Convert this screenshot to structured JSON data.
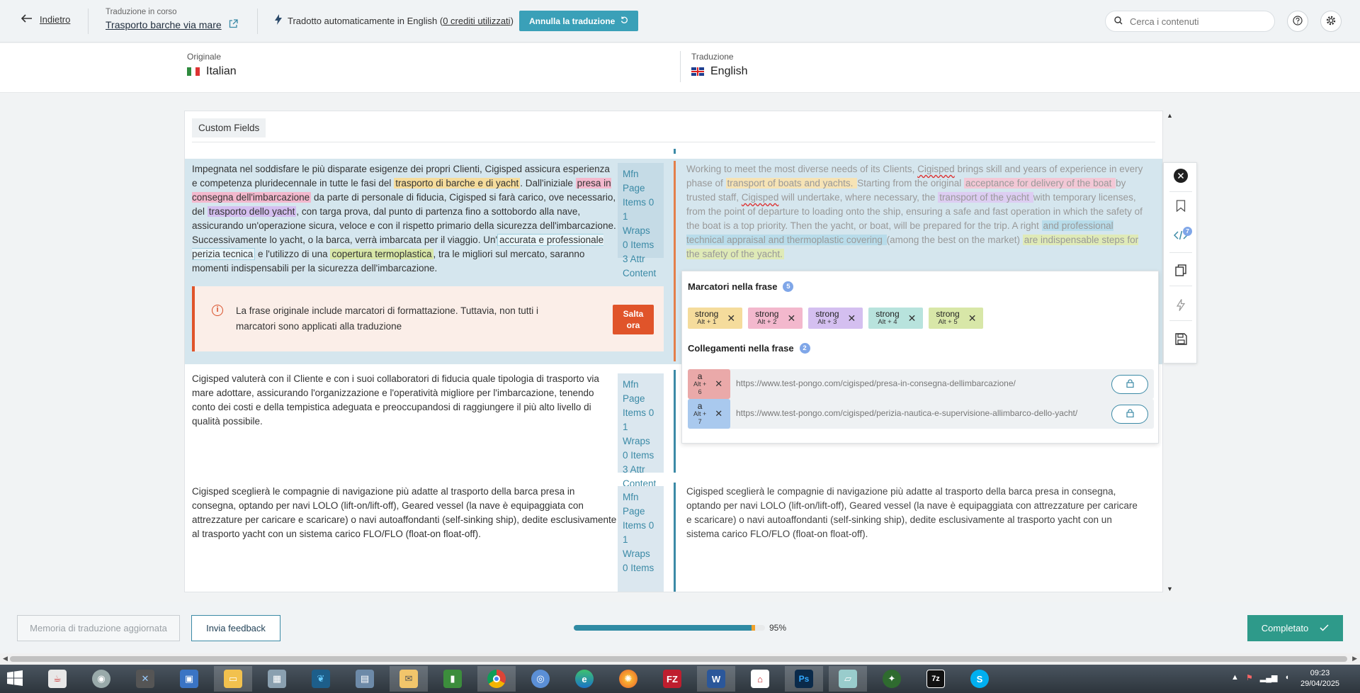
{
  "header": {
    "back_label": "Indietro",
    "status_label": "Traduzione in corso",
    "project_name": "Trasporto barche via mare",
    "auto_text": "Tradotto automaticamente in English (",
    "credits_text": "0 crediti utilizzati",
    "auto_close": ")",
    "cancel_button": "Annulla la traduzione",
    "search_placeholder": "Cerca i contenuti"
  },
  "languages": {
    "original_label": "Originale",
    "original_name": "Italian",
    "translation_label": "Traduzione",
    "translation_name": "English"
  },
  "section": {
    "label": "Custom Fields"
  },
  "segments": [
    {
      "source": [
        {
          "t": "Impegnata nel soddisfare le più disparate esigenze dei propri Clienti, Cigisped assicura esperienza e competenza pluridecennale in tutte le fasi del "
        },
        {
          "t": "trasporto di barche e di yacht",
          "h": "y"
        },
        {
          "t": ". Dall'iniziale "
        },
        {
          "t": "presa in consegna dell'imbarcazione",
          "h": "p"
        },
        {
          "t": " da parte di personale di fiducia, Cigisped si farà carico, ove necessario, del "
        },
        {
          "t": "trasporto dello yacht",
          "h": "v"
        },
        {
          "t": ", con targa prova, dal punto di partenza fino a sottobordo alla nave, assicurando un'operazione sicura, veloce e con il rispetto primario della sicurezza dell'imbarcazione. Successivamente lo yacht, o la barca, verrà imbarcata per il viaggio. Un'"
        },
        {
          "t": "accurata e professionale perizia tecnica",
          "h": "b"
        },
        {
          "t": " e l'utilizzo di una "
        },
        {
          "t": "copertura termoplastica",
          "h": "g"
        },
        {
          "t": ", tra le migliori sul mercato, saranno momenti indispensabili per la sicurezza dell'imbarcazione."
        }
      ],
      "meta": [
        "Mfn",
        "Page",
        "Items 0",
        "1",
        "Wraps",
        "0 Items",
        "3 Attr",
        "Content"
      ],
      "target": [
        {
          "t": "Working to meet the most diverse needs of its Clients, "
        },
        {
          "t": "Cigisped",
          "s": true
        },
        {
          "t": " brings skill and years of experience in every phase of "
        },
        {
          "t": "transport of boats and yachts. ",
          "h": "y"
        },
        {
          "t": " Starting from the original "
        },
        {
          "t": "acceptance for delivery of the boat ",
          "h": "p"
        },
        {
          "t": " by trusted staff, "
        },
        {
          "t": "Cigisped",
          "s": true
        },
        {
          "t": " will undertake, where necessary, the "
        },
        {
          "t": "transport of the yacht ",
          "h": "v"
        },
        {
          "t": " with temporary licenses, from the point of departure to loading onto the ship, ensuring a safe and fast operation in which the safety of the boat is a top priority. Then the yacht, or boat, will be prepared for the trip. A right "
        },
        {
          "t": " and professional technical appraisal and thermoplastic covering ",
          "h": "b"
        },
        {
          "t": " (among the best on the market) "
        },
        {
          "t": " are indispensable steps for the safety of the yacht. ",
          "h": "g"
        }
      ]
    },
    {
      "source_text": "Cigisped valuterà con il Cliente e con i suoi collaboratori di fiducia quale tipologia di trasporto via mare adottare, assicurando l'organizzazione e l'operatività migliore per l'imbarcazione, tenendo conto dei costi e della tempistica adeguata e preoccupandosi di raggiungere il più alto livello di qualità possibile.",
      "meta": [
        "Mfn",
        "Page",
        "Items 0",
        "1",
        "Wraps",
        "0 Items",
        "3 Attr",
        "Content"
      ]
    },
    {
      "source_text": "Cigisped sceglierà le compagnie di navigazione più adatte al trasporto della barca presa in consegna, optando per navi LOLO (lift-on/lift-off), Geared vessel (la nave è equipaggiata con attrezzature per caricare e scaricare) o navi autoaffondanti (self-sinking ship), dedite esclusivamente al trasporto yacht con un sistema carico FLO/FLO (float-on float-off).",
      "target_text": "Cigisped sceglierà le compagnie di navigazione più adatte al trasporto della barca presa in consegna, optando per navi LOLO (lift-on/lift-off), Geared vessel (la nave è equipaggiata con attrezzature per caricare e scaricare) o navi autoaffondanti (self-sinking ship), dedite esclusivamente al trasporto yacht con un sistema carico FLO/FLO (float-on float-off).",
      "meta": [
        "Mfn",
        "Page",
        "Items 0",
        "1",
        "Wraps",
        "0 Items"
      ]
    }
  ],
  "warning": {
    "text": "La frase originale include marcatori di formattazione. Tuttavia, non tutti i marcatori sono applicati alla traduzione",
    "button_line1": "Salta",
    "button_line2": "ora"
  },
  "tags_panel": {
    "markers_title": "Marcatori nella frase",
    "markers_count": "5",
    "markers": [
      {
        "name": "strong",
        "shortcut": "Alt + 1",
        "color": "#f5dc9c"
      },
      {
        "name": "strong",
        "shortcut": "Alt + 2",
        "color": "#f3b8cd"
      },
      {
        "name": "strong",
        "shortcut": "Alt + 3",
        "color": "#d4bff0"
      },
      {
        "name": "strong",
        "shortcut": "Alt + 4",
        "color": "#b8e3dd"
      },
      {
        "name": "strong",
        "shortcut": "Alt + 5",
        "color": "#d8e7a8"
      }
    ],
    "links_title": "Collegamenti nella frase",
    "links_count": "2",
    "links": [
      {
        "name": "a",
        "shortcut1": "Alt +",
        "shortcut2": "6",
        "color": "#eaa9a9",
        "url": "https://www.test-pongo.com/cigisped/presa-in-consegna-dellimbarcazione/"
      },
      {
        "name": "a",
        "shortcut1": "Alt +",
        "shortcut2": "7",
        "color": "#a9c9ee",
        "url": "https://www.test-pongo.com/cigisped/perizia-nautica-e-supervisione-allimbarco-dello-yacht/"
      }
    ]
  },
  "side_tools": {
    "tags_badge": "7"
  },
  "footer": {
    "memory_button": "Memoria di traduzione aggiornata",
    "feedback_button": "Invia feedback",
    "progress": 0.95,
    "progress_label": "95%",
    "done_button": "Completato"
  },
  "taskbar": {
    "time": "09:23",
    "date": "29/04/2025",
    "ftp_label": "FZ",
    "word_label": "W",
    "ps_label": "Ps",
    "zip_label": "7z",
    "skype_label": "S"
  }
}
